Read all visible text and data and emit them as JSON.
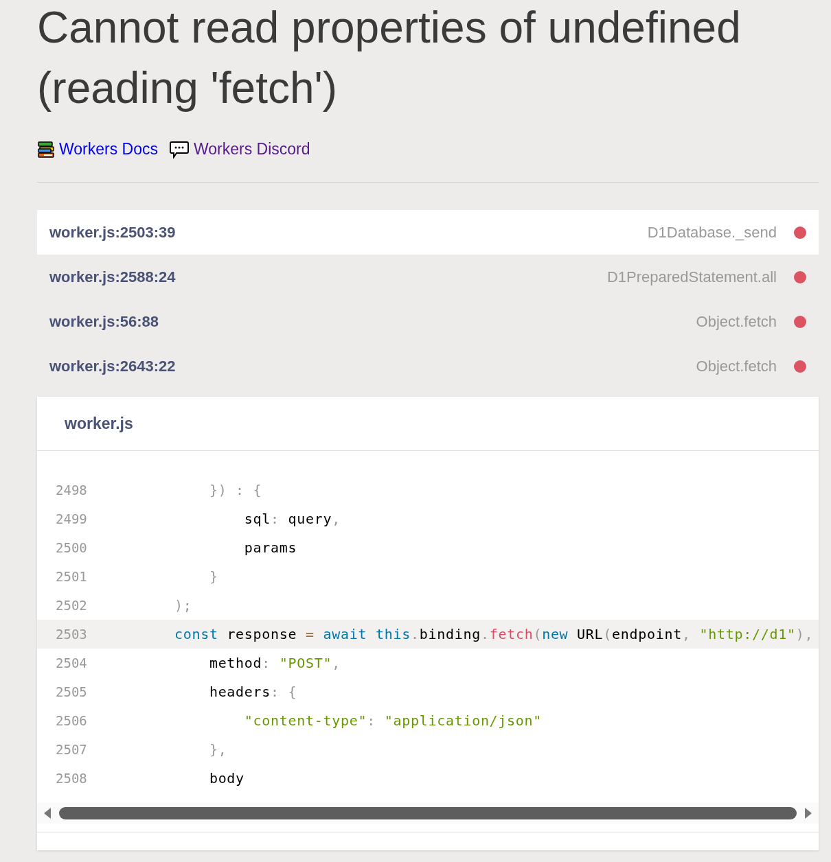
{
  "title": "Cannot read properties of undefined (reading 'fetch')",
  "links": [
    {
      "label": "Workers Docs",
      "kind": "docs",
      "visited": false
    },
    {
      "label": "Workers Discord",
      "kind": "chat",
      "visited": true
    }
  ],
  "frames": [
    {
      "file": "worker.js:2503:39",
      "function": "D1Database._send",
      "selected": true
    },
    {
      "file": "worker.js:2588:24",
      "function": "D1PreparedStatement.all",
      "selected": false
    },
    {
      "file": "worker.js:56:88",
      "function": "Object.fetch",
      "selected": false
    },
    {
      "file": "worker.js:2643:22",
      "function": "Object.fetch",
      "selected": false
    }
  ],
  "code": {
    "file": "worker.js",
    "lines": [
      {
        "number": "2498",
        "highlighted": false,
        "tokens": [
          {
            "text": "            })",
            "kind": "punct"
          },
          {
            "text": " : ",
            "kind": "punct"
          },
          {
            "text": "{",
            "kind": "punct"
          }
        ]
      },
      {
        "number": "2499",
        "highlighted": false,
        "tokens": [
          {
            "text": "                sql",
            "kind": "plain"
          },
          {
            "text": ":",
            "kind": "punct"
          },
          {
            "text": " query",
            "kind": "plain"
          },
          {
            "text": ",",
            "kind": "punct"
          }
        ]
      },
      {
        "number": "2500",
        "highlighted": false,
        "tokens": [
          {
            "text": "                params",
            "kind": "plain"
          }
        ]
      },
      {
        "number": "2501",
        "highlighted": false,
        "tokens": [
          {
            "text": "            }",
            "kind": "punct"
          }
        ]
      },
      {
        "number": "2502",
        "highlighted": false,
        "tokens": [
          {
            "text": "        );",
            "kind": "punct"
          }
        ]
      },
      {
        "number": "2503",
        "highlighted": true,
        "tokens": [
          {
            "text": "        const",
            "kind": "keyword"
          },
          {
            "text": " response ",
            "kind": "plain"
          },
          {
            "text": "=",
            "kind": "operator"
          },
          {
            "text": " await",
            "kind": "keyword"
          },
          {
            "text": " this",
            "kind": "keyword"
          },
          {
            "text": ".",
            "kind": "punct"
          },
          {
            "text": "binding",
            "kind": "plain"
          },
          {
            "text": ".",
            "kind": "punct"
          },
          {
            "text": "fetch",
            "kind": "function"
          },
          {
            "text": "(",
            "kind": "punct"
          },
          {
            "text": "new",
            "kind": "keyword"
          },
          {
            "text": " URL",
            "kind": "plain"
          },
          {
            "text": "(",
            "kind": "punct"
          },
          {
            "text": "endpoint",
            "kind": "plain"
          },
          {
            "text": ",",
            "kind": "punct"
          },
          {
            "text": " \"http://d1\"",
            "kind": "string"
          },
          {
            "text": "),",
            "kind": "punct"
          }
        ]
      },
      {
        "number": "2504",
        "highlighted": false,
        "tokens": [
          {
            "text": "            method",
            "kind": "plain"
          },
          {
            "text": ":",
            "kind": "punct"
          },
          {
            "text": " \"POST\"",
            "kind": "string"
          },
          {
            "text": ",",
            "kind": "punct"
          }
        ]
      },
      {
        "number": "2505",
        "highlighted": false,
        "tokens": [
          {
            "text": "            headers",
            "kind": "plain"
          },
          {
            "text": ":",
            "kind": "punct"
          },
          {
            "text": " {",
            "kind": "punct"
          }
        ]
      },
      {
        "number": "2506",
        "highlighted": false,
        "tokens": [
          {
            "text": "                \"content-type\"",
            "kind": "string"
          },
          {
            "text": ":",
            "kind": "punct"
          },
          {
            "text": " \"application/json\"",
            "kind": "string"
          }
        ]
      },
      {
        "number": "2507",
        "highlighted": false,
        "tokens": [
          {
            "text": "            },",
            "kind": "punct"
          }
        ]
      },
      {
        "number": "2508",
        "highlighted": false,
        "tokens": [
          {
            "text": "            body",
            "kind": "plain"
          }
        ]
      }
    ]
  }
}
